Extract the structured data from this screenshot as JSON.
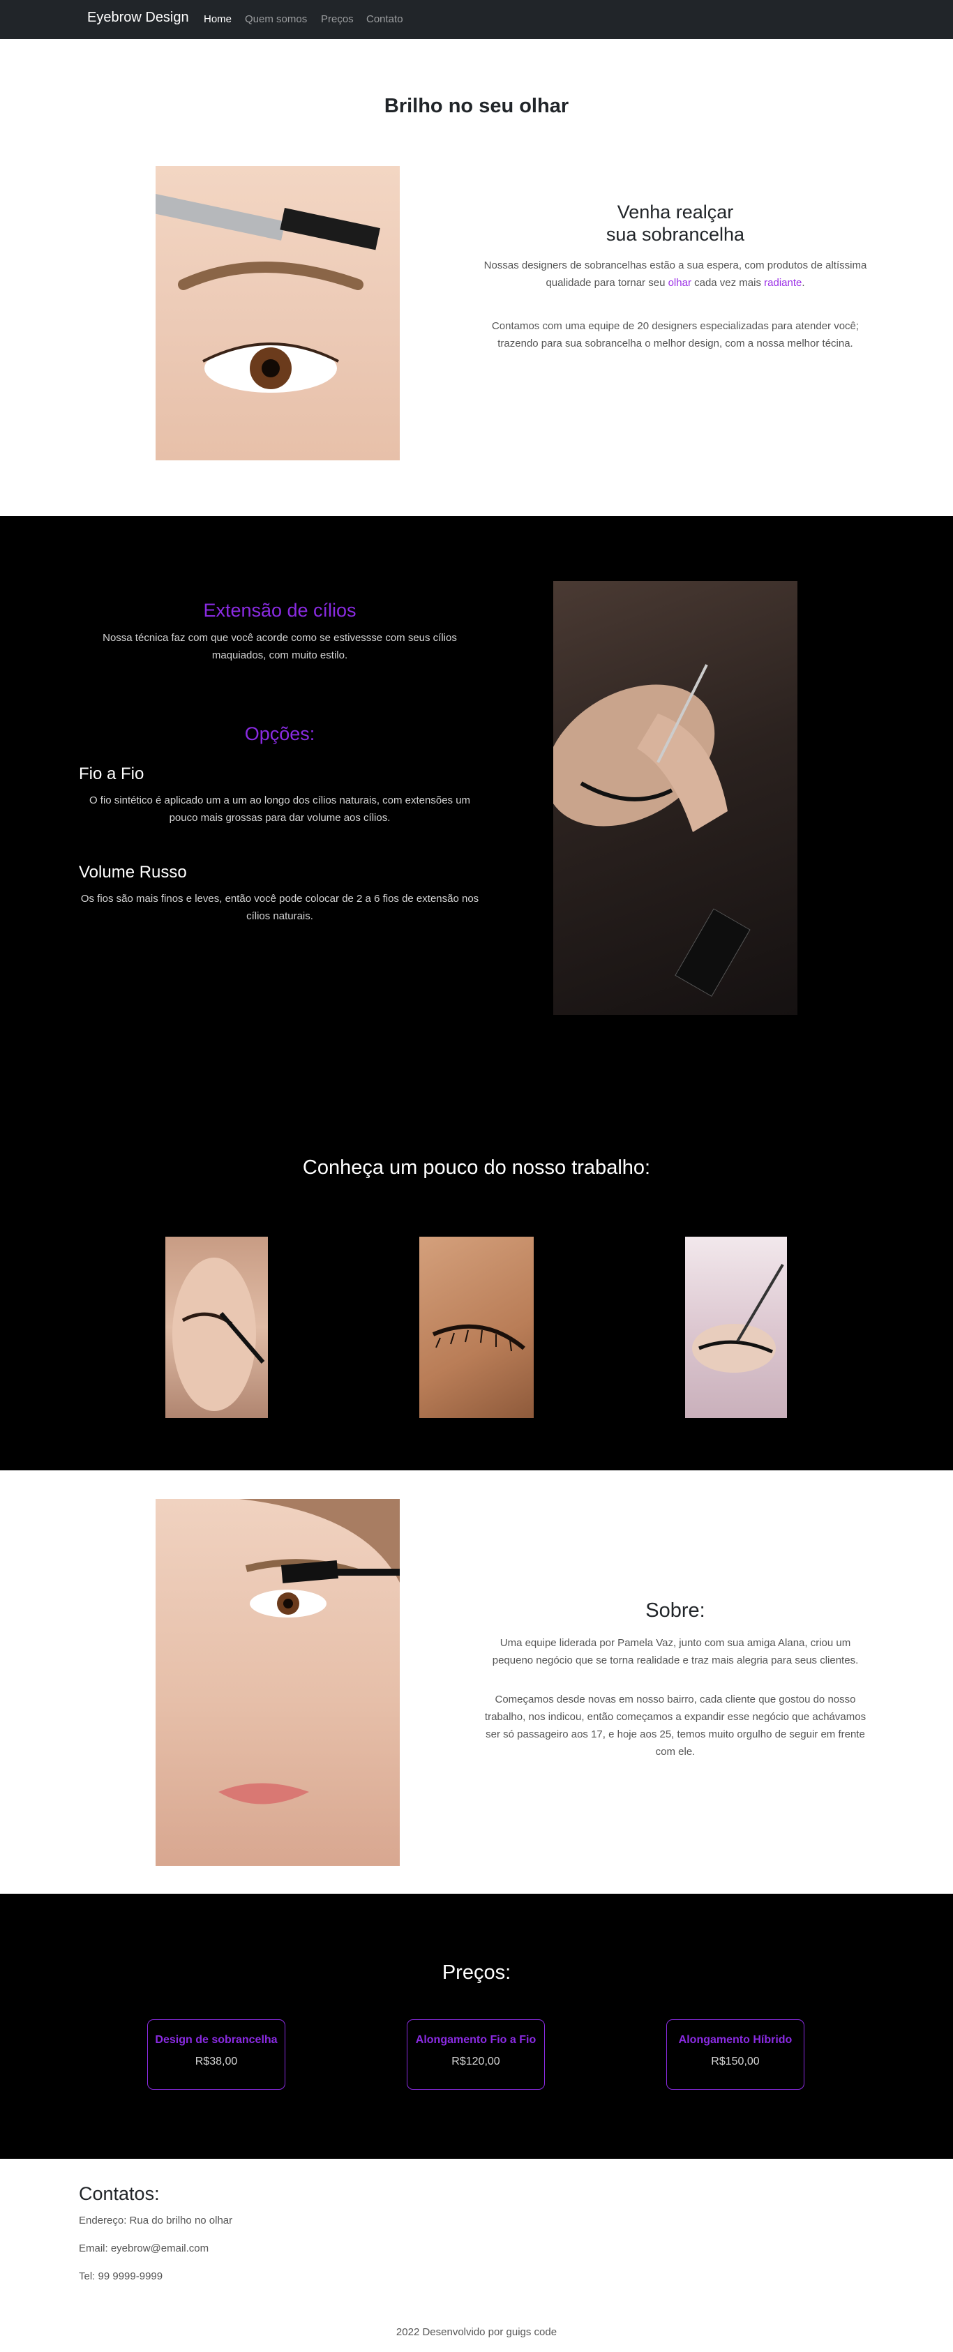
{
  "navbar": {
    "brand": "Eyebrow Design",
    "links": [
      "Home",
      "Quem somos",
      "Preços",
      "Contato"
    ]
  },
  "hero": {
    "title": "Brilho no seu olhar",
    "heading_line1": "Venha realçar",
    "heading_line2": "sua sobrancelha",
    "p1_part1": "Nossas designers de sobrancelhas estão a sua espera, com produtos de altíssima qualidade para tornar seu ",
    "p1_highlight1": "olhar",
    "p1_part2": " cada vez mais ",
    "p1_highlight2": "radiante",
    "p1_part3": ".",
    "p2": "Contamos com uma equipe de 20 designers especializadas para atender você; trazendo para sua sobrancelha o melhor design, com a nossa melhor técina."
  },
  "lashes": {
    "title": "Extensão de cílios",
    "intro": "Nossa técnica faz com que você acorde como se estivessse com seus cílios maquiados, com muito estilo.",
    "options_title": "Opções:",
    "option1_title": "Fio a Fio",
    "option1_text": "O fio sintético é aplicado um a um ao longo dos cílios naturais, com extensões um pouco mais grossas para dar volume aos cílios.",
    "option2_title": "Volume Russo",
    "option2_text": "Os fios são mais finos e leves, então você pode colocar de 2 a 6 fios de extensão nos cílios naturais."
  },
  "work": {
    "title": "Conheça um pouco do nosso trabalho:"
  },
  "about": {
    "title": "Sobre:",
    "p1": "Uma equipe liderada por Pamela Vaz, junto com sua amiga Alana, criou um pequeno negócio que se torna realidade e traz mais alegria para seus clientes.",
    "p2": "Começamos desde novas em nosso bairro, cada cliente que gostou do nosso trabalho, nos indicou, então começamos a expandir esse negócio que achávamos ser só passageiro aos 17, e hoje aos 25, temos muito orgulho de seguir em frente com ele."
  },
  "prices": {
    "title": "Preços:",
    "items": [
      {
        "name": "Design de sobrancelha",
        "value": "R$38,00"
      },
      {
        "name": "Alongamento Fio a Fio",
        "value": "R$120,00"
      },
      {
        "name": "Alongamento Híbrido",
        "value": "R$150,00"
      }
    ]
  },
  "contacts": {
    "title": "Contatos:",
    "address": "Endereço: Rua do brilho no olhar",
    "email": "Email: eyebrow@email.com",
    "phone": "Tel: 99 9999-9999"
  },
  "footer": {
    "text": "2022 Desenvolvido por guigs code"
  },
  "colors": {
    "accent": "#8a2be2",
    "navbar": "#212529",
    "dark_section": "#000000"
  }
}
